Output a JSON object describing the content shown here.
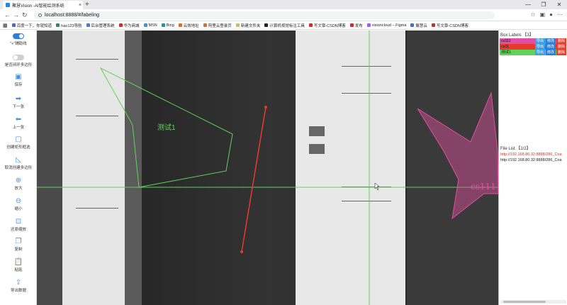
{
  "browser": {
    "tab_title": "聚慧Vision -AI智能绘测系统",
    "tab_close": "×",
    "new_tab": "+",
    "url": "localhost:8888/#/labeling",
    "win_min": "—",
    "win_max": "❐",
    "win_close": "✕",
    "bookmarks": [
      {
        "label": "百度一下，你就知道",
        "color": "#3b6fe0"
      },
      {
        "label": "hao123导航",
        "color": "#2e8b57"
      },
      {
        "label": "后台管理系统",
        "color": "#4f7cc9"
      },
      {
        "label": "华为商城",
        "color": "#d12b2b"
      },
      {
        "label": "MSN",
        "color": "#2f9be0"
      },
      {
        "label": "Bing",
        "color": "#1a9a9a"
      },
      {
        "label": "云效地址",
        "color": "#e36b1b"
      },
      {
        "label": "阿里云登录页",
        "color": "#e36b1b"
      },
      {
        "label": "新建文件夹",
        "color": "#e7b840"
      },
      {
        "label": "计算机视觉标注工具",
        "color": "#222222"
      },
      {
        "label": "写文章-CSDN博客",
        "color": "#d12b2b"
      },
      {
        "label": "发布",
        "color": "#d12b2b"
      },
      {
        "label": "visioncloud – Figma",
        "color": "#a259ff"
      },
      {
        "label": "聚慧云",
        "color": "#3b6fe0"
      },
      {
        "label": "写文章-CSDN博客",
        "color": "#d12b2b"
      }
    ]
  },
  "tools": {
    "crosshair": "\"+\"辅助线",
    "polygon_toggle": "是否闭环多边形",
    "save": "保存",
    "next": "下一张",
    "prev": "上一张",
    "create_rect": "创建矩形框选",
    "cancel_polygon": "取消创建多边形",
    "zoom_in": "放大",
    "zoom_out": "缩小",
    "reset_zoom": "还原缩放",
    "copy": "复制",
    "paste": "粘贴",
    "export": "导出数据"
  },
  "labels_panel": {
    "title": "Box Labels 【3】",
    "export_label": "导出",
    "edit_label": "修改",
    "delete_label": "删除",
    "rows": [
      {
        "name": "cs111",
        "color": "#e04fa0"
      },
      {
        "name": "cs11",
        "color": "#e63a2e"
      },
      {
        "name": "测试1",
        "color": "#5fd35a"
      }
    ]
  },
  "file_panel": {
    "title": "File List 【1/2】",
    "files": [
      {
        "path": "http://192.168.80.32:8888/286_Coa",
        "active": true
      },
      {
        "path": "http://192.168.80.32:8888/286_Coa",
        "active": false
      }
    ]
  },
  "canvas": {
    "label_polygon": "测试1",
    "label_star": "cs111"
  },
  "colors": {
    "green": "#5fd35a",
    "pink": "#e04fa0",
    "red": "#e63a2e",
    "accent": "#2b7fd9"
  }
}
